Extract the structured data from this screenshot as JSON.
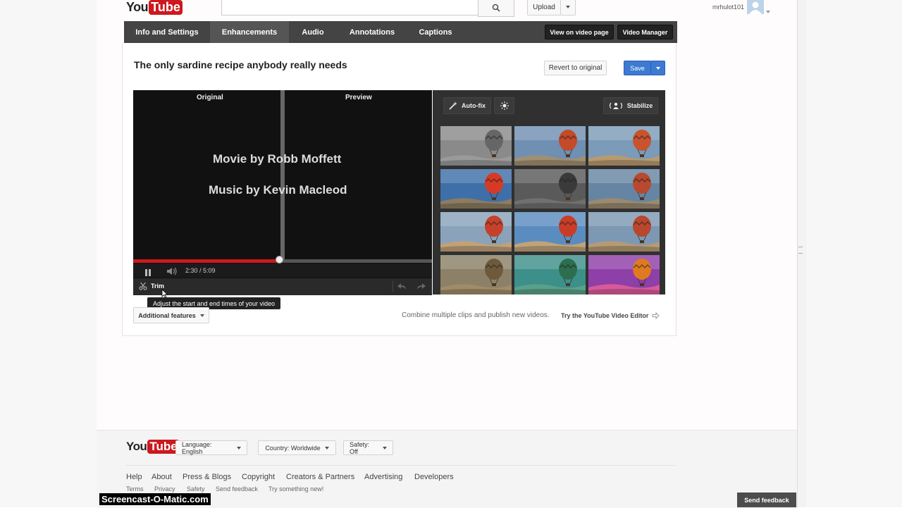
{
  "header": {
    "logo_you": "You",
    "logo_tube": "Tube",
    "upload_label": "Upload",
    "username": "mrhulot101"
  },
  "tabs": [
    {
      "label": "Info and Settings"
    },
    {
      "label": "Enhancements"
    },
    {
      "label": "Audio"
    },
    {
      "label": "Annotations"
    },
    {
      "label": "Captions"
    }
  ],
  "tab_buttons": {
    "view_on_video_page": "View on video page",
    "video_manager": "Video Manager"
  },
  "editor": {
    "video_title": "The only sardine recipe anybody really needs",
    "revert_label": "Revert to original",
    "save_label": "Save",
    "original_label": "Original",
    "preview_label": "Preview",
    "credit_line_1": "Movie by Robb Moffett",
    "credit_line_2": "Music by Kevin Macleod",
    "time_display": "2:30 / 5:09",
    "progress_fraction": 0.49,
    "trim_label": "Trim",
    "trim_tooltip": "Adjust the start and end times of your video",
    "autofix_label": "Auto-fix",
    "stabilize_label": "Stabilize",
    "additional_features_label": "Additional features",
    "combine_text": "Combine multiple clips and publish new videos.",
    "try_editor_label": "Try the YouTube Video Editor"
  },
  "filter_thumbnails": [
    {
      "name": "filter-1",
      "sky": "#8a8a8a",
      "balloon": "#666666",
      "ground": "#9a9a9a"
    },
    {
      "name": "filter-2",
      "sky": "#6f8fb3",
      "balloon": "#c44a2a",
      "ground": "#a08f72"
    },
    {
      "name": "filter-3",
      "sky": "#7b9bb8",
      "balloon": "#c9532e",
      "ground": "#b89a70"
    },
    {
      "name": "filter-4",
      "sky": "#3f6fa8",
      "balloon": "#d63a25",
      "ground": "#8c7c62"
    },
    {
      "name": "filter-5",
      "sky": "#5a5a5a",
      "balloon": "#3a3a3a",
      "ground": "#707070"
    },
    {
      "name": "filter-6",
      "sky": "#6685a3",
      "balloon": "#b8492f",
      "ground": "#9a8a70"
    },
    {
      "name": "filter-7",
      "sky": "#8aa3bb",
      "balloon": "#c5412a",
      "ground": "#c2a178"
    },
    {
      "name": "filter-8",
      "sky": "#5b8cc0",
      "balloon": "#c93d28",
      "ground": "#c0a37a"
    },
    {
      "name": "filter-9",
      "sky": "#7d98b2",
      "balloon": "#b9472e",
      "ground": "#b59a74"
    },
    {
      "name": "filter-10",
      "sky": "#8c8068",
      "balloon": "#6e5a3a",
      "ground": "#a08c68"
    },
    {
      "name": "filter-11",
      "sky": "#3d8f8a",
      "balloon": "#2c6e4e",
      "ground": "#5aa08a"
    },
    {
      "name": "filter-12",
      "sky": "#8e3fa8",
      "balloon": "#e07a20",
      "ground": "#d85a9a"
    }
  ],
  "footer": {
    "language_label": "Language: English",
    "country_label": "Country: Worldwide",
    "safety_label": "Safety: Off",
    "main_links": [
      "Help",
      "About",
      "Press & Blogs",
      "Copyright",
      "Creators & Partners",
      "Advertising",
      "Developers"
    ],
    "small_links": [
      "Terms",
      "Privacy",
      "Safety",
      "Send feedback",
      "Try something new!"
    ],
    "send_feedback_label": "Send feedback"
  },
  "watermark": "Screencast-O-Matic.com"
}
